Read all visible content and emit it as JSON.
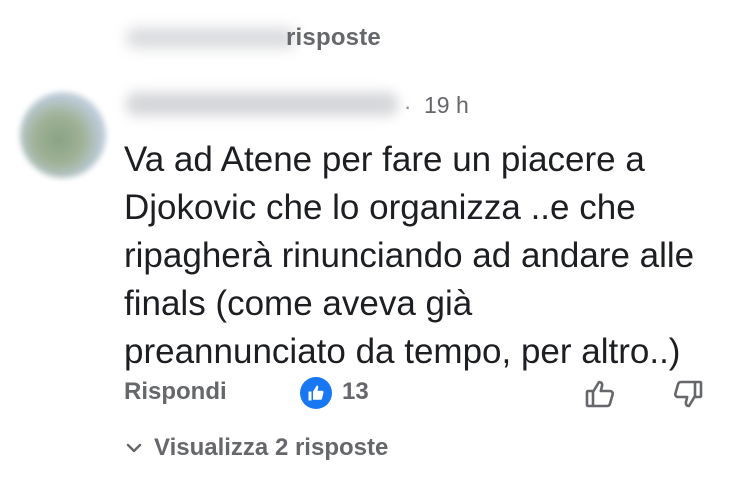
{
  "previous_replies": {
    "label": "risposte"
  },
  "comment": {
    "timestamp_separator": "·",
    "timestamp": "19 h",
    "lines": [
      "Va ad Atene per fare un piacere a",
      "Djokovic che lo organizza ..e che",
      "ripagherà rinunciando ad andare alle",
      "finals (come aveva già",
      "preannunciato da tempo, per altro..)"
    ]
  },
  "actions": {
    "reply_label": "Rispondi",
    "like_count": "13",
    "icons": [
      "like-reaction-icon",
      "thumb-up-icon",
      "thumb-down-icon"
    ]
  },
  "replies": {
    "view_label": "Visualizza 2 risposte",
    "icon": "chevron-down-icon"
  },
  "colors": {
    "accent": "#1877f2",
    "secondary_text": "#65676b",
    "primary_text": "#1c1e21"
  }
}
